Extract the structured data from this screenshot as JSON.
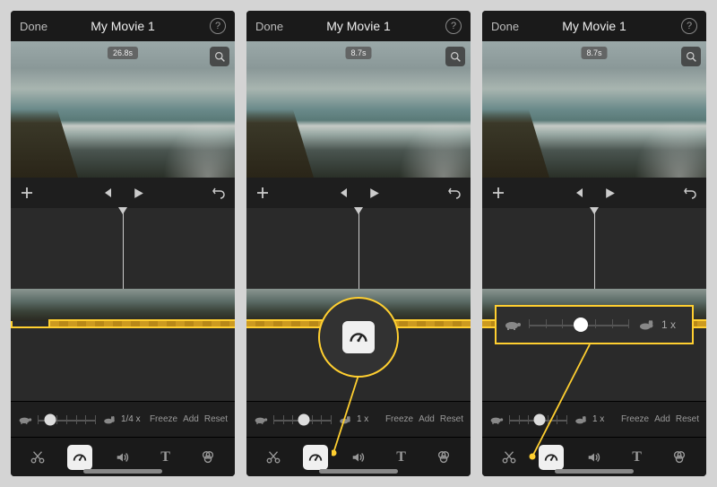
{
  "screens": [
    {
      "header": {
        "done": "Done",
        "title": "My Movie 1"
      },
      "preview": {
        "time_badge": "26.8s"
      },
      "speed": {
        "value": "1/4 x",
        "freeze": "Freeze",
        "add": "Add",
        "reset": "Reset",
        "knob_pct": 22
      },
      "tools_active": "speed"
    },
    {
      "header": {
        "done": "Done",
        "title": "My Movie 1"
      },
      "preview": {
        "time_badge": "8.7s"
      },
      "speed": {
        "value": "1 x",
        "freeze": "Freeze",
        "add": "Add",
        "reset": "Reset",
        "knob_pct": 52
      },
      "tools_active": "speed",
      "callout": "speed-icon-zoom"
    },
    {
      "header": {
        "done": "Done",
        "title": "My Movie 1"
      },
      "preview": {
        "time_badge": "8.7s"
      },
      "speed": {
        "value": "1 x",
        "freeze": "Freeze",
        "add": "Add",
        "reset": "Reset",
        "knob_pct": 52
      },
      "tools_active": "speed",
      "callout": "speed-slider-zoom",
      "callout_slider": {
        "value": "1 x",
        "knob_pct": 52
      }
    }
  ],
  "icons": {
    "help": "?",
    "zoom": "magnifier",
    "add_clip": "plus",
    "prev": "skip-back",
    "play": "play",
    "undo": "undo",
    "turtle": "turtle",
    "rabbit": "rabbit",
    "scissors": "cut",
    "speed": "speedometer",
    "volume": "speaker",
    "text": "T",
    "filter": "three-circles"
  },
  "colors": {
    "accent": "#ffcf30",
    "bg": "#1a1a1a"
  }
}
